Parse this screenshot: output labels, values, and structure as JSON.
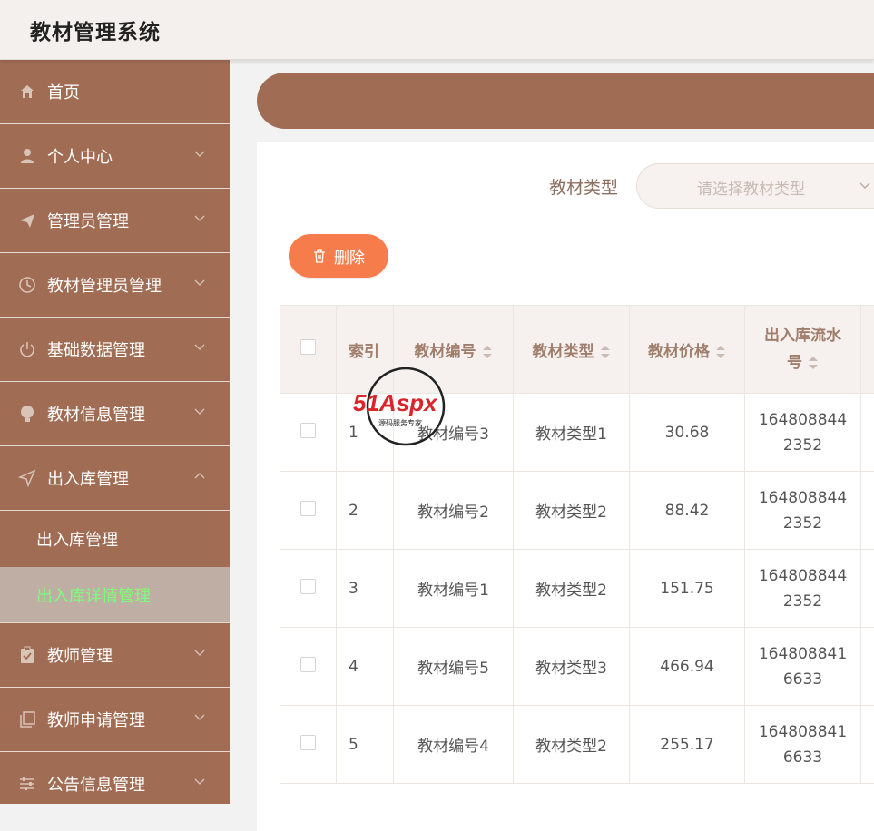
{
  "app": {
    "title": "教材管理系统"
  },
  "sidebar": {
    "items": [
      {
        "label": "首页",
        "icon": "home-icon",
        "expandable": false
      },
      {
        "label": "个人中心",
        "icon": "user-icon",
        "expandable": true
      },
      {
        "label": "管理员管理",
        "icon": "send-icon",
        "expandable": true
      },
      {
        "label": "教材管理员管理",
        "icon": "clock-icon",
        "expandable": true
      },
      {
        "label": "基础数据管理",
        "icon": "power-icon",
        "expandable": true
      },
      {
        "label": "教材信息管理",
        "icon": "bulb-icon",
        "expandable": true
      },
      {
        "label": "出入库管理",
        "icon": "navigation-icon",
        "expandable": true,
        "expanded": true,
        "children": [
          {
            "label": "出入库管理",
            "active": false
          },
          {
            "label": "出入库详情管理",
            "active": true
          }
        ]
      },
      {
        "label": "教师管理",
        "icon": "clipboard-icon",
        "expandable": true
      },
      {
        "label": "教师申请管理",
        "icon": "copy-icon",
        "expandable": true
      },
      {
        "label": "公告信息管理",
        "icon": "sliders-icon",
        "expandable": true
      }
    ]
  },
  "filter": {
    "label": "教材类型",
    "placeholder": "请选择教材类型"
  },
  "toolbar": {
    "delete_label": "删除"
  },
  "table": {
    "columns": [
      "索引",
      "教材编号",
      "教材类型",
      "教材价格",
      "出入库流水\n号"
    ],
    "rows": [
      {
        "index": "1",
        "code": "教材编号3",
        "type": "教材类型1",
        "price": "30.68",
        "flow1": "164808844",
        "flow2": "2352"
      },
      {
        "index": "2",
        "code": "教材编号2",
        "type": "教材类型2",
        "price": "88.42",
        "flow1": "164808844",
        "flow2": "2352"
      },
      {
        "index": "3",
        "code": "教材编号1",
        "type": "教材类型2",
        "price": "151.75",
        "flow1": "164808844",
        "flow2": "2352"
      },
      {
        "index": "4",
        "code": "教材编号5",
        "type": "教材类型3",
        "price": "466.94",
        "flow1": "164808841",
        "flow2": "6633"
      },
      {
        "index": "5",
        "code": "教材编号4",
        "type": "教材类型2",
        "price": "255.17",
        "flow1": "164808841",
        "flow2": "6633"
      }
    ]
  },
  "watermark": {
    "brand": "51Aspx",
    "tagline": "源码服务专家"
  },
  "colors": {
    "sidebar": "#a06d54",
    "accent_button": "#f77c4c",
    "active_sub": "#7dff7a",
    "header_text": "#a07e6c"
  }
}
